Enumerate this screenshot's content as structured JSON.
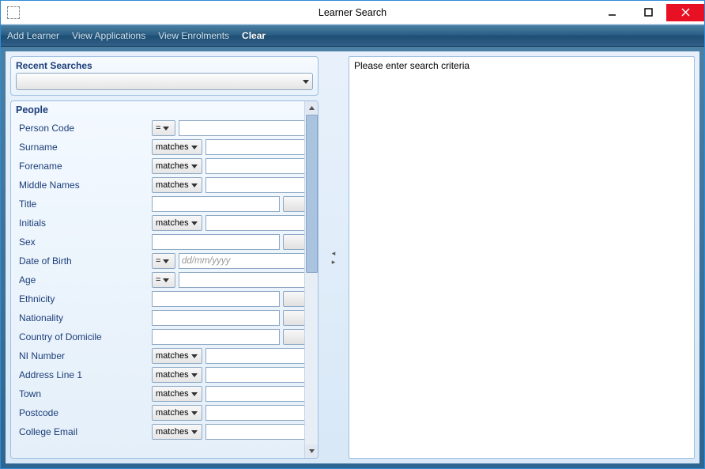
{
  "window": {
    "title": "Learner Search"
  },
  "menubar": {
    "items": [
      {
        "label": "Add Learner",
        "active": false
      },
      {
        "label": "View Applications",
        "active": false
      },
      {
        "label": "View Enrolments",
        "active": false
      },
      {
        "label": "Clear",
        "active": true
      }
    ]
  },
  "recent": {
    "title": "Recent Searches"
  },
  "people": {
    "title": "People",
    "rows": [
      {
        "label": "Person Code",
        "op": "=",
        "op_small": true,
        "input": true,
        "combo": false,
        "wide": false
      },
      {
        "label": "Surname",
        "op": "matches",
        "op_small": false,
        "input": true,
        "combo": false,
        "wide": false
      },
      {
        "label": "Forename",
        "op": "matches",
        "op_small": false,
        "input": true,
        "combo": false,
        "wide": false
      },
      {
        "label": "Middle Names",
        "op": "matches",
        "op_small": false,
        "input": true,
        "combo": false,
        "wide": false
      },
      {
        "label": "Title",
        "op": null,
        "op_small": false,
        "input": true,
        "combo": true,
        "wide": true
      },
      {
        "label": "Initials",
        "op": "matches",
        "op_small": false,
        "input": true,
        "combo": false,
        "wide": false
      },
      {
        "label": "Sex",
        "op": null,
        "op_small": false,
        "input": true,
        "combo": true,
        "wide": true
      },
      {
        "label": "Date of Birth",
        "op": "=",
        "op_small": true,
        "input": true,
        "combo": false,
        "wide": false,
        "date": true,
        "placeholder": "dd/mm/yyyy"
      },
      {
        "label": "Age",
        "op": "=",
        "op_small": true,
        "input": true,
        "combo": false,
        "wide": false
      },
      {
        "label": "Ethnicity",
        "op": null,
        "op_small": false,
        "input": true,
        "combo": true,
        "wide": true
      },
      {
        "label": "Nationality",
        "op": null,
        "op_small": false,
        "input": true,
        "combo": true,
        "wide": true
      },
      {
        "label": "Country of Domicile",
        "op": null,
        "op_small": false,
        "input": true,
        "combo": true,
        "wide": true
      },
      {
        "label": "NI Number",
        "op": "matches",
        "op_small": false,
        "input": true,
        "combo": false,
        "wide": false
      },
      {
        "label": "Address Line 1",
        "op": "matches",
        "op_small": false,
        "input": true,
        "combo": false,
        "wide": false
      },
      {
        "label": "Town",
        "op": "matches",
        "op_small": false,
        "input": true,
        "combo": false,
        "wide": false
      },
      {
        "label": "Postcode",
        "op": "matches",
        "op_small": false,
        "input": true,
        "combo": false,
        "wide": false
      },
      {
        "label": "College Email",
        "op": "matches",
        "op_small": false,
        "input": true,
        "combo": false,
        "wide": false
      }
    ]
  },
  "results": {
    "placeholder": "Please enter search criteria"
  }
}
